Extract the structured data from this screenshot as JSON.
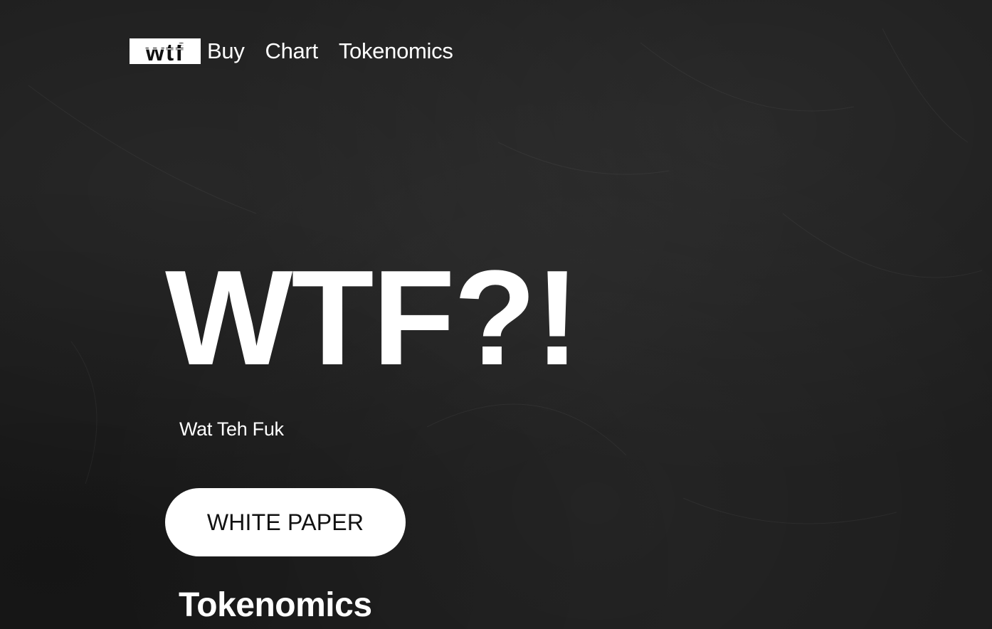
{
  "nav": {
    "logo_text": "wtf",
    "links": [
      "Buy",
      "Chart",
      "Tokenomics"
    ]
  },
  "hero": {
    "title": "WTF?!",
    "subtitle": "Wat Teh Fuk",
    "button_label": "WHITE PAPER"
  },
  "sections": {
    "tokenomics_heading": "Tokenomics"
  },
  "colors": {
    "background": "#1c1c1c",
    "text": "#ffffff",
    "button_bg": "#ffffff",
    "button_text": "#111111"
  },
  "icons": {
    "logo": "wtf-logo-icon"
  }
}
